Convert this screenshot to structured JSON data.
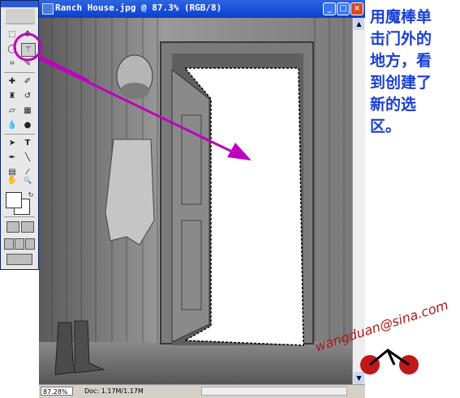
{
  "document": {
    "title": "Ranch House.jpg @ 87.3% (RGB/8)",
    "zoom": "87.28%",
    "doc_info": "Doc: 1.17M/1.17M",
    "window_buttons": {
      "minimize": "_",
      "maximize": "□",
      "close": "×"
    }
  },
  "toolbox": {
    "tools": [
      {
        "name": "marquee",
        "glyph": "⬚"
      },
      {
        "name": "move",
        "glyph": "✥"
      },
      {
        "name": "lasso",
        "glyph": "◯"
      },
      {
        "name": "magic-wand",
        "glyph": "⚚"
      },
      {
        "name": "crop",
        "glyph": "⌗"
      },
      {
        "name": "slice",
        "glyph": "✎"
      },
      {
        "name": "healing",
        "glyph": "✚"
      },
      {
        "name": "brush",
        "glyph": "✐"
      },
      {
        "name": "stamp",
        "glyph": "♜"
      },
      {
        "name": "history-brush",
        "glyph": "↺"
      },
      {
        "name": "eraser",
        "glyph": "▱"
      },
      {
        "name": "gradient",
        "glyph": "▦"
      },
      {
        "name": "blur",
        "glyph": "💧"
      },
      {
        "name": "dodge",
        "glyph": "●"
      },
      {
        "name": "path-select",
        "glyph": "➤"
      },
      {
        "name": "type",
        "glyph": "T"
      },
      {
        "name": "pen",
        "glyph": "✒"
      },
      {
        "name": "line",
        "glyph": "╲"
      },
      {
        "name": "notes",
        "glyph": "▤"
      },
      {
        "name": "eyedropper",
        "glyph": "⁄"
      },
      {
        "name": "hand",
        "glyph": "✋"
      },
      {
        "name": "zoom",
        "glyph": "🔍"
      }
    ],
    "colors": {
      "foreground": "#ffffff",
      "background": "#ffffff"
    }
  },
  "instruction": {
    "text": "用魔棒单\n击门外的\n地方，看\n到创建了\n新的选\n区。"
  },
  "watermark": {
    "text": "wangduan@sina.com"
  },
  "colors": {
    "instruction": "#1a3fd0",
    "annotation": "#c000c0",
    "title_bar": "#0a3fd0"
  }
}
